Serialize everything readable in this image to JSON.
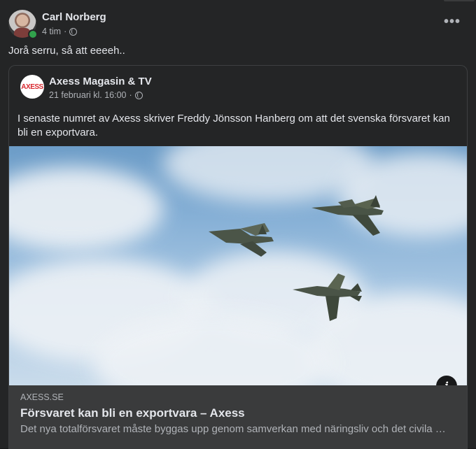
{
  "post": {
    "author": "Carl Norberg",
    "time": "4 tim",
    "separator": "·",
    "text": "Jorå serru, så att eeeeh..",
    "more_label": "•••",
    "icons": {
      "privacy": "globe-icon",
      "more": "more-options-icon",
      "online": "online-status-dot"
    },
    "colors": {
      "online": "#31a24c",
      "background": "#242526"
    }
  },
  "shared": {
    "page_name": "Axess Magasin & TV",
    "logo_text": "AXESS",
    "date": "21 februari kl. 16:00",
    "separator": "·",
    "text": "I senaste numret av Axess skriver Freddy Jönsson Hanberg om att det svenska försvaret kan bli en exportvara.",
    "photo_alt": "",
    "colors": {
      "logo_red": "#d8282f"
    }
  },
  "link": {
    "domain": "AXESS.SE",
    "title": "Försvaret kan bli en exportvara – Axess",
    "description": "Det nya totalförsvaret måste byggas upp genom samverkan med näringsliv och det civila …",
    "info_label": "i"
  }
}
